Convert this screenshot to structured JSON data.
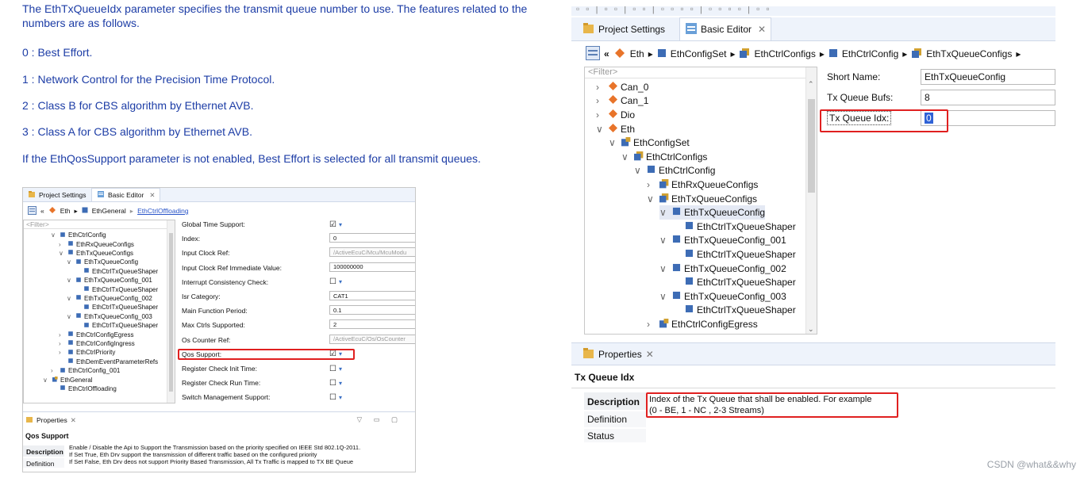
{
  "doc": {
    "intro": "The EthTxQueueIdx parameter specifies the transmit queue number to use. The features related to the numbers are as follows.",
    "items": [
      "0 : Best Effort.",
      "1 : Network Control for the Precision Time Protocol.",
      "2 : Class B for CBS algorithm by Ethernet AVB.",
      "3 : Class A for CBS algorithm by Ethernet AVB."
    ],
    "note": "If the EthQosSupport parameter is not enabled, Best Effort is selected for all transmit queues."
  },
  "small_editor": {
    "tabs": [
      "Project Settings",
      "Basic Editor"
    ],
    "breadcrumb": [
      "Eth",
      "EthGeneral",
      "EthCtrlOffloading"
    ],
    "filter_placeholder": "<Filter>",
    "tree": [
      {
        "label": "EthCtrlConfig",
        "depth": 0,
        "arrow": "v"
      },
      {
        "label": "EthRxQueueConfigs",
        "depth": 1,
        "arrow": ">"
      },
      {
        "label": "EthTxQueueConfigs",
        "depth": 1,
        "arrow": "v"
      },
      {
        "label": "EthTxQueueConfig",
        "depth": 2,
        "arrow": "v"
      },
      {
        "label": "EthCtrlTxQueueShaper",
        "depth": 3,
        "arrow": ""
      },
      {
        "label": "EthTxQueueConfig_001",
        "depth": 2,
        "arrow": "v"
      },
      {
        "label": "EthCtrlTxQueueShaper",
        "depth": 3,
        "arrow": ""
      },
      {
        "label": "EthTxQueueConfig_002",
        "depth": 2,
        "arrow": "v"
      },
      {
        "label": "EthCtrlTxQueueShaper",
        "depth": 3,
        "arrow": ""
      },
      {
        "label": "EthTxQueueConfig_003",
        "depth": 2,
        "arrow": "v"
      },
      {
        "label": "EthCtrlTxQueueShaper",
        "depth": 3,
        "arrow": ""
      },
      {
        "label": "EthCtrlConfigEgress",
        "depth": 1,
        "arrow": ">"
      },
      {
        "label": "EthCtrlConfigIngress",
        "depth": 1,
        "arrow": ">"
      },
      {
        "label": "EthCtrlPriority",
        "depth": 1,
        "arrow": ">"
      },
      {
        "label": "EthDemEventParameterRefs",
        "depth": 1,
        "arrow": ""
      },
      {
        "label": "EthCtrlConfig_001",
        "depth": 0,
        "arrow": ">"
      },
      {
        "label": "EthGeneral",
        "depth": -1,
        "arrow": "v"
      },
      {
        "label": "EthCtrlOffloading",
        "depth": 0,
        "arrow": ""
      }
    ],
    "form": [
      {
        "label": "Global Time Support:",
        "kind": "check",
        "value": "☑"
      },
      {
        "label": "Index:",
        "kind": "text",
        "value": "0"
      },
      {
        "label": "Input Clock Ref:",
        "kind": "dis",
        "value": "/ActiveEcuC/Mcu/McuModu"
      },
      {
        "label": "Input Clock Ref Immediate Value:",
        "kind": "text",
        "value": "100000000"
      },
      {
        "label": "Interrupt Consistency Check:",
        "kind": "check",
        "value": "☐"
      },
      {
        "label": "Isr Category:",
        "kind": "text",
        "value": "CAT1"
      },
      {
        "label": "Main Function Period:",
        "kind": "text",
        "value": "0.1"
      },
      {
        "label": "Max Ctrls Supported:",
        "kind": "text",
        "value": "2"
      },
      {
        "label": "Os Counter Ref:",
        "kind": "dis",
        "value": "/ActiveEcuC/Os/OsCounter"
      },
      {
        "label": "Qos Support:",
        "kind": "check",
        "value": "☑"
      },
      {
        "label": "Register Check Init Time:",
        "kind": "check",
        "value": "☐"
      },
      {
        "label": "Register Check Run Time:",
        "kind": "check",
        "value": "☐"
      },
      {
        "label": "Switch Management Support:",
        "kind": "check",
        "value": "☐"
      }
    ],
    "props_tab": "Properties",
    "props_title": "Qos Support",
    "props_side": [
      "Description",
      "Definition"
    ],
    "props_text": [
      "Enable / Disable the Api to Support the Transmission based on the priority specified on IEEE Std 802.1Q-2011.",
      "If Set True, Eth Drv support the transmission of different traffic based on the configured priority",
      "If Set False, Eth Drv deos not support Priority Based Transmission, All Tx Traffic is mapped to TX BE Queue"
    ]
  },
  "big_editor": {
    "tabs": [
      "Project Settings",
      "Basic Editor"
    ],
    "breadcrumb": [
      "Eth",
      "EthConfigSet",
      "EthCtrlConfigs",
      "EthCtrlConfig",
      "EthTxQueueConfigs"
    ],
    "filter_placeholder": "<Filter>",
    "tree": [
      {
        "label": "Can_0",
        "depth": 0,
        "arrow": ">",
        "kind": "module"
      },
      {
        "label": "Can_1",
        "depth": 0,
        "arrow": ">",
        "kind": "module"
      },
      {
        "label": "Dio",
        "depth": 0,
        "arrow": ">",
        "kind": "module"
      },
      {
        "label": "Eth",
        "depth": 0,
        "arrow": "v",
        "kind": "module"
      },
      {
        "label": "EthConfigSet",
        "depth": 1,
        "arrow": "v",
        "kind": "set"
      },
      {
        "label": "EthCtrlConfigs",
        "depth": 2,
        "arrow": "v",
        "kind": "multi"
      },
      {
        "label": "EthCtrlConfig",
        "depth": 3,
        "arrow": "v",
        "kind": "cont"
      },
      {
        "label": "EthRxQueueConfigs",
        "depth": 4,
        "arrow": ">",
        "kind": "multi"
      },
      {
        "label": "EthTxQueueConfigs",
        "depth": 4,
        "arrow": "v",
        "kind": "multi"
      },
      {
        "label": "EthTxQueueConfig",
        "depth": 5,
        "arrow": "v",
        "kind": "cont"
      },
      {
        "label": "EthCtrlTxQueueShaper",
        "depth": 6,
        "arrow": "",
        "kind": "cont"
      },
      {
        "label": "EthTxQueueConfig_001",
        "depth": 5,
        "arrow": "v",
        "kind": "cont"
      },
      {
        "label": "EthCtrlTxQueueShaper",
        "depth": 6,
        "arrow": "",
        "kind": "cont"
      },
      {
        "label": "EthTxQueueConfig_002",
        "depth": 5,
        "arrow": "v",
        "kind": "cont"
      },
      {
        "label": "EthCtrlTxQueueShaper",
        "depth": 6,
        "arrow": "",
        "kind": "cont"
      },
      {
        "label": "EthTxQueueConfig_003",
        "depth": 5,
        "arrow": "v",
        "kind": "cont"
      },
      {
        "label": "EthCtrlTxQueueShaper",
        "depth": 6,
        "arrow": "",
        "kind": "cont"
      },
      {
        "label": "EthCtrlConfigEgress",
        "depth": 4,
        "arrow": ">",
        "kind": "set"
      }
    ],
    "form": [
      {
        "label": "Short Name:",
        "value": "EthTxQueueConfig"
      },
      {
        "label": "Tx Queue Bufs:",
        "value": "8"
      },
      {
        "label": "Tx Queue Idx:",
        "value": "0"
      }
    ],
    "props_tab": "Properties",
    "props_title": "Tx Queue Idx",
    "props_side": [
      "Description",
      "Definition",
      "Status"
    ],
    "props_text": [
      "Index of the Tx Queue that shall be enabled. For example",
      "(0 - BE, 1 - NC , 2-3 Streams)"
    ]
  },
  "watermark": "CSDN @what&&why",
  "colors": {
    "accent_red": "#e02020",
    "doc_text": "#1d3da6",
    "tab_bg": "#eef3fb"
  }
}
